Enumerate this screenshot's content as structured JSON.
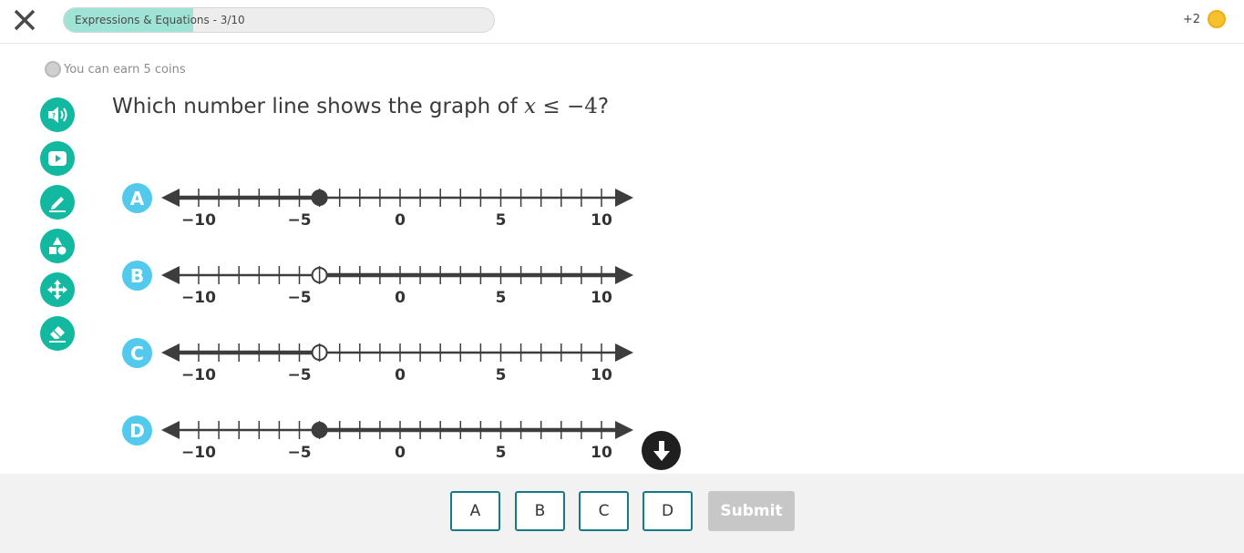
{
  "header": {
    "progress_label": "Expressions & Equations - 3/10",
    "progress_fraction": 0.3,
    "coins_label": "+2",
    "close_icon": "close-icon",
    "coin_icon": "coin-icon"
  },
  "earn": {
    "text": "You can earn 5 coins",
    "icon": "coin-outline-icon"
  },
  "tools": [
    {
      "name": "read-aloud",
      "icon": "speaker-icon"
    },
    {
      "name": "video",
      "icon": "play-icon"
    },
    {
      "name": "draw",
      "icon": "pencil-icon"
    },
    {
      "name": "shapes",
      "icon": "shapes-icon"
    },
    {
      "name": "move",
      "icon": "move-icon"
    },
    {
      "name": "eraser",
      "icon": "eraser-icon"
    }
  ],
  "question": {
    "prefix": "Which number line shows the graph of ",
    "variable": "x",
    "relation": " ≤ −4",
    "suffix": "?"
  },
  "number_line": {
    "min": -11,
    "max": 11,
    "labels": [
      -10,
      -5,
      0,
      5,
      10
    ],
    "label_texts": [
      "−10",
      "−5",
      "0",
      "5",
      "10"
    ]
  },
  "options": [
    {
      "label": "A",
      "point": -4,
      "closed": true,
      "direction": "left"
    },
    {
      "label": "B",
      "point": -4,
      "closed": false,
      "direction": "right"
    },
    {
      "label": "C",
      "point": -4,
      "closed": false,
      "direction": "left"
    },
    {
      "label": "D",
      "point": -4,
      "closed": true,
      "direction": "right"
    }
  ],
  "footer": {
    "answers": [
      "A",
      "B",
      "C",
      "D"
    ],
    "submit_label": "Submit"
  },
  "colors": {
    "accent_teal": "#13b8a0",
    "badge_blue": "#52c9ed",
    "progress_fill": "#9fe3d6",
    "line": "#3d3d3d",
    "answer_border": "#157a87",
    "submit_disabled": "#c7c7c7"
  }
}
